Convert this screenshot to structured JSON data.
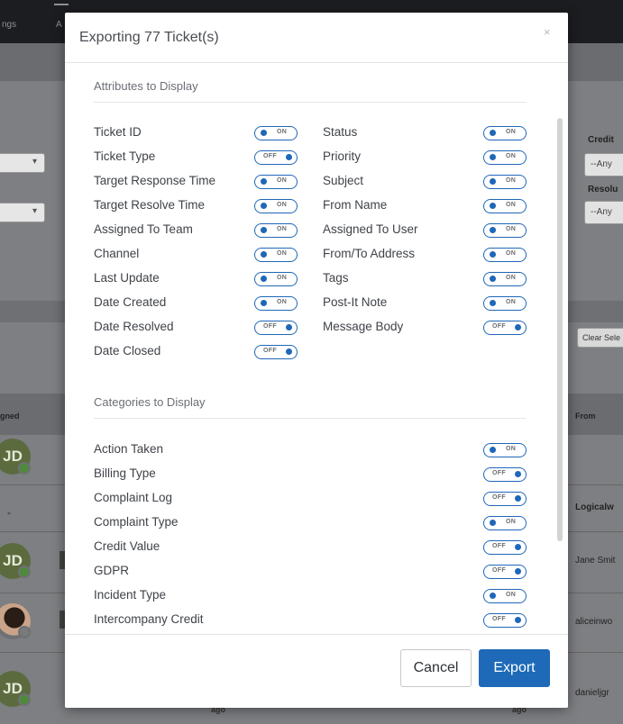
{
  "background": {
    "nav_items": [
      "ngs",
      "A"
    ],
    "left_selects": [
      "▾",
      "▾"
    ],
    "right_labels": [
      "Credit",
      "Resolu"
    ],
    "right_selects": [
      "--Any",
      "--Any"
    ],
    "clear_button": "Clear Sele",
    "columns": {
      "assigned": "gned",
      "from": "From"
    },
    "avatar_initials": [
      "JD",
      "JD",
      "JD"
    ],
    "dash": "-",
    "from_values": [
      "Logicalw",
      "Jane Smit",
      "aliceinwo",
      "danieljgr"
    ],
    "ago": [
      "ago",
      "ago"
    ]
  },
  "modal": {
    "title": "Exporting 77 Ticket(s)",
    "close": "×",
    "attributes_heading": "Attributes to Display",
    "categories_heading": "Categories to Display",
    "attributes_left": [
      {
        "label": "Ticket ID",
        "on": true
      },
      {
        "label": "Ticket Type",
        "on": false
      },
      {
        "label": "Target Response Time",
        "on": true
      },
      {
        "label": "Target Resolve Time",
        "on": true
      },
      {
        "label": "Assigned To Team",
        "on": true
      },
      {
        "label": "Channel",
        "on": true
      },
      {
        "label": "Last Update",
        "on": true
      },
      {
        "label": "Date Created",
        "on": true
      },
      {
        "label": "Date Resolved",
        "on": false
      },
      {
        "label": "Date Closed",
        "on": false
      }
    ],
    "attributes_right": [
      {
        "label": "Status",
        "on": true
      },
      {
        "label": "Priority",
        "on": true
      },
      {
        "label": "Subject",
        "on": true
      },
      {
        "label": "From Name",
        "on": true
      },
      {
        "label": "Assigned To User",
        "on": true
      },
      {
        "label": "From/To Address",
        "on": true
      },
      {
        "label": "Tags",
        "on": true
      },
      {
        "label": "Post-It Note",
        "on": true
      },
      {
        "label": "Message Body",
        "on": false
      }
    ],
    "categories": [
      {
        "label": "Action Taken",
        "on": true
      },
      {
        "label": "Billing Type",
        "on": false
      },
      {
        "label": "Complaint Log",
        "on": false
      },
      {
        "label": "Complaint Type",
        "on": true
      },
      {
        "label": "Credit Value",
        "on": false
      },
      {
        "label": "GDPR",
        "on": false
      },
      {
        "label": "Incident Type",
        "on": true
      },
      {
        "label": "Intercompany Credit",
        "on": false
      }
    ],
    "toggle_on_text": "ON",
    "toggle_off_text": "OFF",
    "cancel_label": "Cancel",
    "export_label": "Export"
  },
  "colors": {
    "accent": "#1e6ab8",
    "overlay": "#7d7f82",
    "avatar": "#5b6b3e",
    "status_green": "#4e8a3a"
  }
}
